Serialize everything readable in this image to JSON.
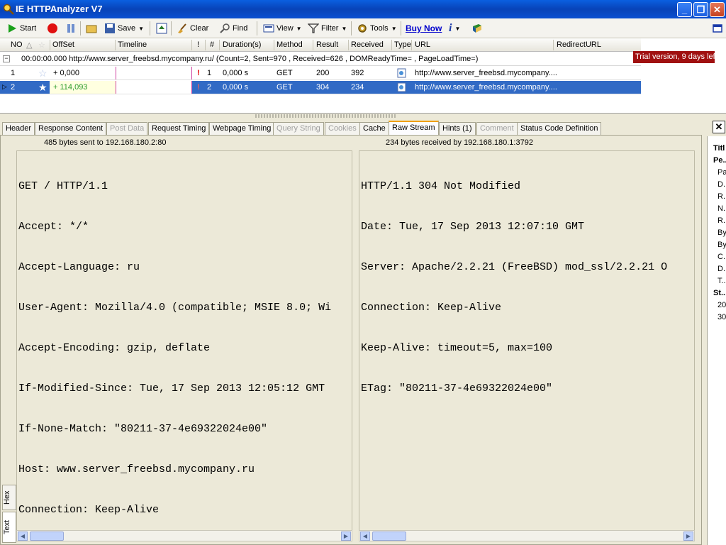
{
  "window": {
    "title": "IE HTTPAnalyzer V7",
    "minimize": "_",
    "restore": "❐",
    "close": "✕"
  },
  "toolbar": {
    "start": "Start",
    "save": "Save",
    "clear": "Clear",
    "find": "Find",
    "view": "View",
    "filter": "Filter",
    "tools": "Tools",
    "buy_now": "Buy Now",
    "info": "i"
  },
  "grid": {
    "columns": [
      "NO",
      "OffSet",
      "Timeline",
      "!",
      "#",
      "Duration(s)",
      "Method",
      "Result",
      "Received",
      "Type",
      "URL",
      "RedirectURL"
    ],
    "group": "00:00:00.000  http://www.server_freebsd.mycompany.ru/  (Count=2, Sent=970 , Received=626 , DOMReadyTime= , PageLoadTime=)",
    "trial": "Trial version, 9 days left",
    "rows": [
      {
        "no": "1",
        "offset": "+ 0,000",
        "flag": "!",
        "num": "1",
        "duration": "0,000 s",
        "method": "GET",
        "result": "200",
        "received": "392",
        "url": "http://www.server_freebsd.mycompany...."
      },
      {
        "no": "2",
        "offset": "+ 114,093",
        "flag": "!",
        "num": "2",
        "duration": "0,000 s",
        "method": "GET",
        "result": "304",
        "received": "234",
        "url": "http://www.server_freebsd.mycompany...."
      }
    ]
  },
  "tabs": [
    "Header",
    "Response Content",
    "Post Data",
    "Request Timing",
    "Webpage Timing",
    "Query String",
    "Cookies",
    "Cache",
    "Raw Stream",
    "Hints (1)",
    "Comment",
    "Status Code Definition"
  ],
  "vtabs": {
    "hex": "Hex",
    "text": "Text"
  },
  "left_pane": {
    "header": "485 bytes sent to 192.168.180.2:80",
    "lines": [
      "GET / HTTP/1.1",
      "Accept: */*",
      "Accept-Language: ru",
      "User-Agent: Mozilla/4.0 (compatible; MSIE 8.0; Wi",
      "Accept-Encoding: gzip, deflate",
      "If-Modified-Since: Tue, 17 Sep 2013 12:05:12 GMT",
      "If-None-Match: \"80211-37-4e69322024e00\"",
      "Host: www.server_freebsd.mycompany.ru",
      "Connection: Keep-Alive"
    ]
  },
  "right_pane": {
    "header": "234 bytes received by 192.168.180.1:3792",
    "lines": [
      "HTTP/1.1 304 Not Modified",
      "Date: Tue, 17 Sep 2013 12:07:10 GMT",
      "Server: Apache/2.2.21 (FreeBSD) mod_ssl/2.2.21 O",
      "Connection: Keep-Alive",
      "Keep-Alive: timeout=5, max=100",
      "ETag: \"80211-37-4e69322024e00\""
    ]
  },
  "side_panel": {
    "items": [
      "Titl",
      "Pe..",
      "Pa",
      "D..",
      "R..",
      "N..",
      "R..",
      "By",
      "By",
      "C..",
      "D..",
      "T..",
      "St..",
      "20",
      "30"
    ]
  },
  "colors": {
    "selection": "#316ac5",
    "trial_bg": "#a01010",
    "title_bar": "#0a5fe0",
    "active_tab_accent": "#f0a000"
  }
}
